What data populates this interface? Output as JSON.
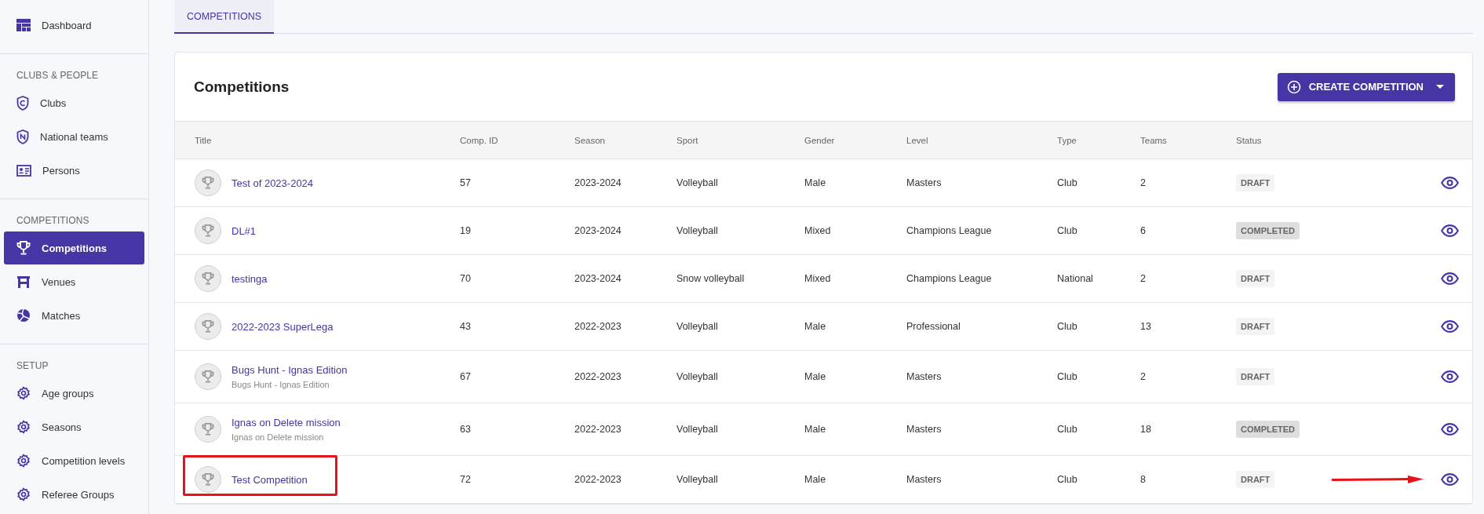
{
  "sidebar": {
    "sections": [
      {
        "items": [
          {
            "label": "Dashboard",
            "selected": false
          }
        ]
      },
      {
        "title": "CLUBS & PEOPLE",
        "items": [
          {
            "label": "Clubs",
            "selected": false
          },
          {
            "label": "National teams",
            "selected": false
          },
          {
            "label": "Persons",
            "selected": false
          }
        ]
      },
      {
        "title": "COMPETITIONS",
        "items": [
          {
            "label": "Competitions",
            "selected": true
          },
          {
            "label": "Venues",
            "selected": false
          },
          {
            "label": "Matches",
            "selected": false
          }
        ]
      },
      {
        "title": "SETUP",
        "items": [
          {
            "label": "Age groups",
            "selected": false
          },
          {
            "label": "Seasons",
            "selected": false
          },
          {
            "label": "Competition levels",
            "selected": false
          },
          {
            "label": "Referee Groups",
            "selected": false
          }
        ]
      }
    ]
  },
  "tabs": [
    {
      "label": "COMPETITIONS",
      "selected": true
    }
  ],
  "card": {
    "title": "Competitions",
    "create_button": "CREATE COMPETITION"
  },
  "table": {
    "columns": [
      "Title",
      "Comp. ID",
      "Season",
      "Sport",
      "Gender",
      "Level",
      "Type",
      "Teams",
      "Status"
    ],
    "rows": [
      {
        "title": "Test of 2023-2024",
        "id": "57",
        "season": "2023-2024",
        "sport": "Volleyball",
        "gender": "Male",
        "level": "Masters",
        "type": "Club",
        "teams": "2",
        "status": "DRAFT",
        "completed": false,
        "annotated": false
      },
      {
        "title": "DL#1",
        "id": "19",
        "season": "2023-2024",
        "sport": "Volleyball",
        "gender": "Mixed",
        "level": "Champions League",
        "type": "Club",
        "teams": "6",
        "status": "COMPLETED",
        "completed": true,
        "annotated": false
      },
      {
        "title": "testinga",
        "id": "70",
        "season": "2023-2024",
        "sport": "Snow volleyball",
        "gender": "Mixed",
        "level": "Champions League",
        "type": "National",
        "teams": "2",
        "status": "DRAFT",
        "completed": false,
        "annotated": false
      },
      {
        "title": "2022-2023 SuperLega",
        "id": "43",
        "season": "2022-2023",
        "sport": "Volleyball",
        "gender": "Male",
        "level": "Professional",
        "type": "Club",
        "teams": "13",
        "status": "DRAFT",
        "completed": false,
        "annotated": false
      },
      {
        "title": "Bugs Hunt - Ignas Edition",
        "subtitle": "Bugs Hunt - Ignas Edition",
        "id": "67",
        "season": "2022-2023",
        "sport": "Volleyball",
        "gender": "Male",
        "level": "Masters",
        "type": "Club",
        "teams": "2",
        "status": "DRAFT",
        "completed": false,
        "annotated": false
      },
      {
        "title": "Ignas on Delete mission",
        "subtitle": "Ignas on Delete mission",
        "id": "63",
        "season": "2022-2023",
        "sport": "Volleyball",
        "gender": "Male",
        "level": "Masters",
        "type": "Club",
        "teams": "18",
        "status": "COMPLETED",
        "completed": true,
        "annotated": false
      },
      {
        "title": "Test Competition",
        "id": "72",
        "season": "2022-2023",
        "sport": "Volleyball",
        "gender": "Male",
        "level": "Masters",
        "type": "Club",
        "teams": "8",
        "status": "DRAFT",
        "completed": false,
        "annotated": true
      }
    ]
  }
}
